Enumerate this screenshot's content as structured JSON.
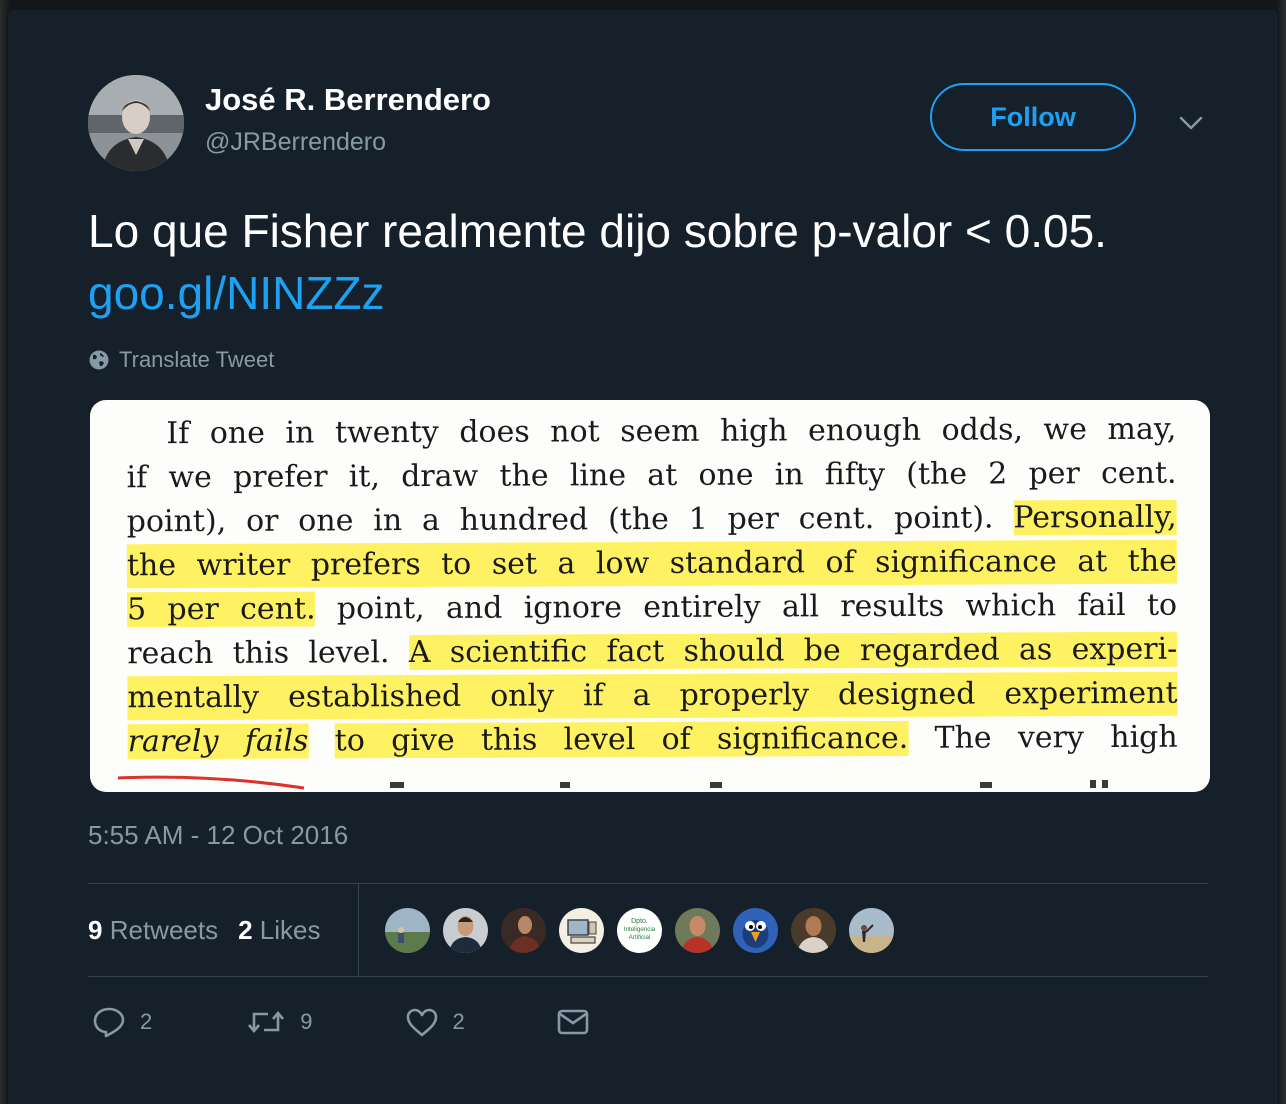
{
  "author": {
    "name": "José R. Berrendero",
    "handle": "@JRBerrendero"
  },
  "follow": {
    "label": "Follow"
  },
  "tweet": {
    "text": "Lo que Fisher realmente dijo sobre p-valor < 0.05.",
    "link": "goo.gl/NINZZz",
    "translate_label": "Translate Tweet",
    "timestamp": "5:55 AM - 12 Oct 2016"
  },
  "media": {
    "lines": [
      [
        "If one in twenty does not seem high enough odds, we may,"
      ],
      [
        "if we prefer it, draw the line at one in fifty (the 2 per cent."
      ],
      [
        "point), or one in a hundred (the 1 per cent. point).",
        "Personally,"
      ],
      [
        "the writer prefers to set a low standard of significance at the"
      ],
      [
        "5 per cent.",
        "point, and ignore entirely all results which fail to"
      ],
      [
        "reach this level.",
        "A scientific fact should be regarded as experi-"
      ],
      [
        "mentally established only if a properly designed experiment"
      ],
      [
        "rarely fails",
        "to give this level of significance.",
        "The very high"
      ]
    ],
    "highlight_color": "#fff046",
    "underline_color": "#d9332a"
  },
  "stats": {
    "retweets_count": "9",
    "retweets_label": "Retweets",
    "likes_count": "2",
    "likes_label": "Likes"
  },
  "likers": [
    {
      "icon": "avatar-landscape-person"
    },
    {
      "icon": "avatar-man-portrait"
    },
    {
      "icon": "avatar-man-speaking"
    },
    {
      "icon": "avatar-computer-illustration"
    },
    {
      "label_lines": [
        "Dpto.",
        "Inteligencia",
        "Artificial"
      ]
    },
    {
      "icon": "avatar-man-red-shirt"
    },
    {
      "icon": "avatar-cartoon-bird"
    },
    {
      "icon": "avatar-man-smiling"
    },
    {
      "icon": "avatar-person-beach"
    }
  ],
  "actions": {
    "reply_count": "2",
    "retweet_count": "9",
    "like_count": "2"
  },
  "colors": {
    "background": "#15202b",
    "accent": "#1da1f2",
    "secondary_text": "#8899a6",
    "divider": "#38444d"
  }
}
